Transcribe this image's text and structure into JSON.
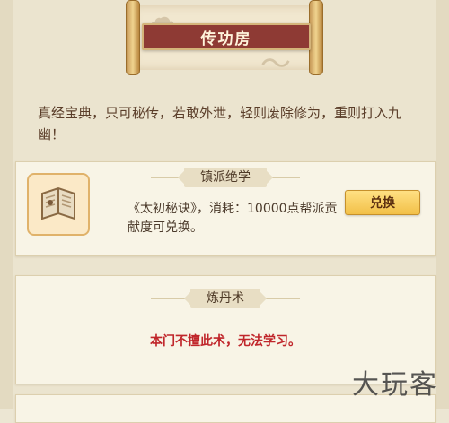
{
  "header": {
    "title": "传功房"
  },
  "description": "真经宝典，只可秘传，若敢外泄，轻则废除修为，重则打入九幽！",
  "sections": [
    {
      "tag": "镇派绝学",
      "item_text": "《太初秘诀》，消耗：10000点帮派贡献度可兑换。",
      "button_label": "兑换",
      "icon": "book-icon"
    },
    {
      "tag": "炼丹术",
      "notice": "本门不擅此术，无法学习。"
    }
  ],
  "watermark": "大玩客",
  "colors": {
    "title_bar": "#8e3a34",
    "notice": "#c0262b",
    "button": "#f2c048"
  }
}
